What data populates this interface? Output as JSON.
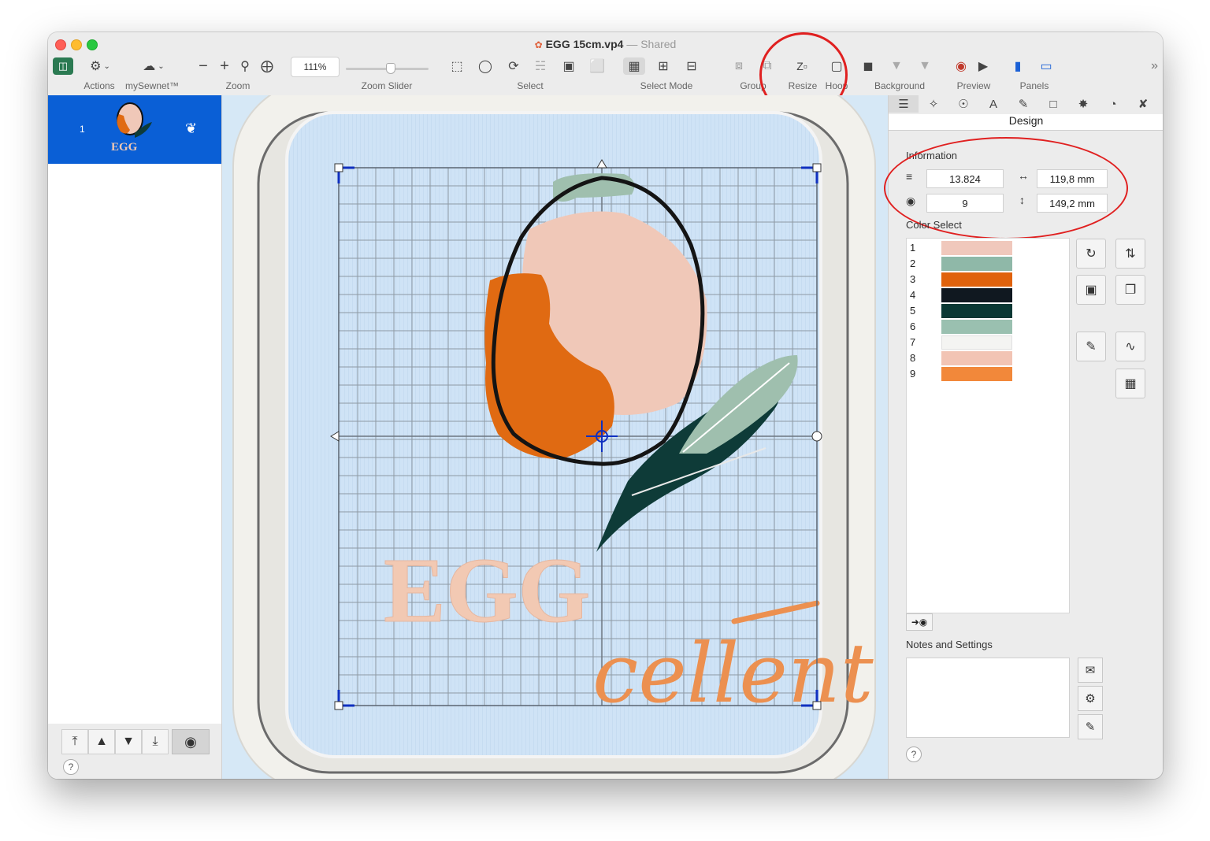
{
  "window": {
    "filename": "EGG 15cm.vp4",
    "separator": "—",
    "status": "Shared"
  },
  "toolbar": {
    "groups": {
      "actions": "Actions",
      "mysewnet": "mySewnet™",
      "zoom": "Zoom",
      "zoom_slider": "Zoom Slider",
      "select": "Select",
      "select_mode": "Select Mode",
      "group": "Group",
      "resize": "Resize",
      "hoop": "Hoop",
      "background": "Background",
      "preview": "Preview",
      "panels": "Panels"
    },
    "zoom_level": "111%",
    "zoom_slider_fraction": 0.5,
    "annotation_color": "#e02020"
  },
  "left_panel": {
    "items": [
      {
        "number": "1",
        "thumbnail_text": "EGG"
      }
    ],
    "selected_color": "#0a5fd6",
    "help": "?"
  },
  "design": {
    "egg_word": "EGG",
    "cellent_word": "cellent",
    "colors": {
      "background": "#d0e4f7",
      "hoop": "#ecebe6",
      "egg_pink": "#f0c8b8",
      "orange": "#e06a12",
      "outline": "#1a1a1a",
      "feather_light": "#9fbfae",
      "feather_dark": "#0e3b38",
      "text_pink": "#f2c9b3",
      "text_orange": "#ec9050",
      "selection": "#1030c0"
    }
  },
  "right_panel": {
    "panel_title": "Design",
    "information": {
      "label": "Information",
      "stitches": "13.824",
      "width": "119,8 mm",
      "colors_count": "9",
      "height": "149,2 mm"
    },
    "color_select": {
      "label": "Color Select",
      "items": [
        {
          "number": "1",
          "color": "#f0c8bc"
        },
        {
          "number": "2",
          "color": "#8fb8a8"
        },
        {
          "number": "3",
          "color": "#e0620c"
        },
        {
          "number": "4",
          "color": "#101820"
        },
        {
          "number": "5",
          "color": "#0a3834"
        },
        {
          "number": "6",
          "color": "#9ac0b0"
        },
        {
          "number": "7",
          "color": "#f4f4f2"
        },
        {
          "number": "8",
          "color": "#f2c4b4"
        },
        {
          "number": "9",
          "color": "#f2883a"
        }
      ]
    },
    "notes": {
      "label": "Notes and Settings",
      "value": ""
    },
    "help": "?"
  }
}
